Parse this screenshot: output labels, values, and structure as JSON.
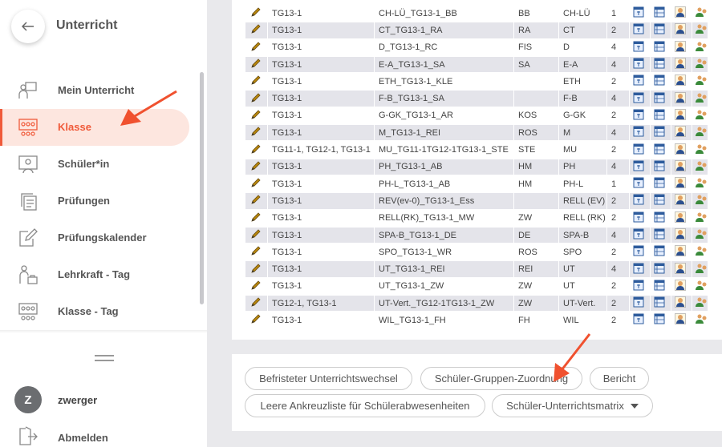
{
  "sidebar": {
    "title": "Unterricht",
    "items": [
      {
        "label": "Mein Unterricht",
        "icon": "person-board-icon"
      },
      {
        "label": "Klasse",
        "icon": "class-group-icon",
        "active": true
      },
      {
        "label": "Schüler*in",
        "icon": "student-icon"
      },
      {
        "label": "Prüfungen",
        "icon": "exams-icon"
      },
      {
        "label": "Prüfungskalender",
        "icon": "calendar-edit-icon"
      },
      {
        "label": "Lehrkraft - Tag",
        "icon": "teacher-bag-icon"
      },
      {
        "label": "Klasse - Tag",
        "icon": "class-day-icon"
      }
    ],
    "user": {
      "initial": "Z",
      "name": "zwerger"
    },
    "logout_label": "Abmelden"
  },
  "table": {
    "rows": [
      {
        "klasse": "TG13-1",
        "name": "CH-LÜ_TG13-1_BB",
        "lehrer": "BB",
        "fach": "CH-LÜ",
        "std": "1"
      },
      {
        "klasse": "TG13-1",
        "name": "CT_TG13-1_RA",
        "lehrer": "RA",
        "fach": "CT",
        "std": "2"
      },
      {
        "klasse": "TG13-1",
        "name": "D_TG13-1_RC",
        "lehrer": "FIS",
        "fach": "D",
        "std": "4"
      },
      {
        "klasse": "TG13-1",
        "name": "E-A_TG13-1_SA",
        "lehrer": "SA",
        "fach": "E-A",
        "std": "4"
      },
      {
        "klasse": "TG13-1",
        "name": "ETH_TG13-1_KLE",
        "lehrer": "",
        "fach": "ETH",
        "std": "2"
      },
      {
        "klasse": "TG13-1",
        "name": "F-B_TG13-1_SA",
        "lehrer": "",
        "fach": "F-B",
        "std": "4"
      },
      {
        "klasse": "TG13-1",
        "name": "G-GK_TG13-1_AR",
        "lehrer": "KOS",
        "fach": "G-GK",
        "std": "2"
      },
      {
        "klasse": "TG13-1",
        "name": "M_TG13-1_REI",
        "lehrer": "ROS",
        "fach": "M",
        "std": "4"
      },
      {
        "klasse": "TG11-1, TG12-1, TG13-1",
        "name": "MU_TG11-1TG12-1TG13-1_STE",
        "lehrer": "STE",
        "fach": "MU",
        "std": "2"
      },
      {
        "klasse": "TG13-1",
        "name": "PH_TG13-1_AB",
        "lehrer": "HM",
        "fach": "PH",
        "std": "4"
      },
      {
        "klasse": "TG13-1",
        "name": "PH-L_TG13-1_AB",
        "lehrer": "HM",
        "fach": "PH-L",
        "std": "1"
      },
      {
        "klasse": "TG13-1",
        "name": "REV(ev-0)_TG13-1_Ess",
        "lehrer": "",
        "fach": "RELL (EV)",
        "std": "2"
      },
      {
        "klasse": "TG13-1",
        "name": "RELL(RK)_TG13-1_MW",
        "lehrer": "ZW",
        "fach": "RELL (RK)",
        "std": "2"
      },
      {
        "klasse": "TG13-1",
        "name": "SPA-B_TG13-1_DE",
        "lehrer": "DE",
        "fach": "SPA-B",
        "std": "4"
      },
      {
        "klasse": "TG13-1",
        "name": "SPO_TG13-1_WR",
        "lehrer": "ROS",
        "fach": "SPO",
        "std": "2"
      },
      {
        "klasse": "TG13-1",
        "name": "UT_TG13-1_REI",
        "lehrer": "REI",
        "fach": "UT",
        "std": "4"
      },
      {
        "klasse": "TG13-1",
        "name": "UT_TG13-1_ZW",
        "lehrer": "ZW",
        "fach": "UT",
        "std": "2"
      },
      {
        "klasse": "TG12-1, TG13-1",
        "name": "UT-Vert._TG12-1TG13-1_ZW",
        "lehrer": "ZW",
        "fach": "UT-Vert.",
        "std": "2"
      },
      {
        "klasse": "TG13-1",
        "name": "WIL_TG13-1_FH",
        "lehrer": "FH",
        "fach": "WIL",
        "std": "2"
      }
    ]
  },
  "buttons": {
    "befristet": "Befristeter Unterrichtswechsel",
    "gruppen": "Schüler-Gruppen-Zuordnung",
    "bericht": "Bericht",
    "ankreuz": "Leere Ankreuzliste für Schülerabwesenheiten",
    "matrix": "Schüler-Unterrichtsmatrix"
  },
  "colors": {
    "accent": "#f05a3a",
    "active_bg": "#fde6df",
    "row_alt": "#e4e4ea"
  }
}
